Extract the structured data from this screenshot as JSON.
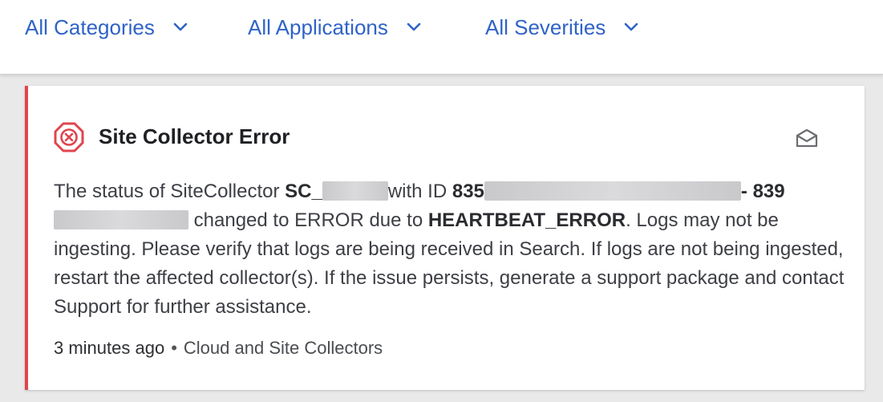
{
  "filters": {
    "category": "All Categories",
    "application": "All Applications",
    "severity": "All Severities"
  },
  "alert": {
    "title": "Site Collector Error",
    "message": {
      "p1": "The status of SiteCollector ",
      "collector_prefix": "SC_",
      "p2": "with ID ",
      "id_prefix": "835",
      "id_suffix_prefix": "-",
      "line2_prefix": "839",
      "p3": " changed to ERROR due to ",
      "error_code": "HEARTBEAT_ERROR",
      "p4": ". Logs may not be ingesting. Please verify that logs are being received in Search. If logs are not being ingested, restart the affected collector(s). If the issue persists, generate a support package and contact Support for further assistance."
    },
    "time": "3 minutes ago",
    "separator": "•",
    "source": "Cloud and Site Collectors"
  },
  "colors": {
    "link_blue": "#2f63c7",
    "error_red": "#e0454d"
  },
  "icons": {
    "chevron": "chevron-down-icon",
    "error": "error-octagon-icon",
    "envelope": "open-envelope-icon"
  }
}
